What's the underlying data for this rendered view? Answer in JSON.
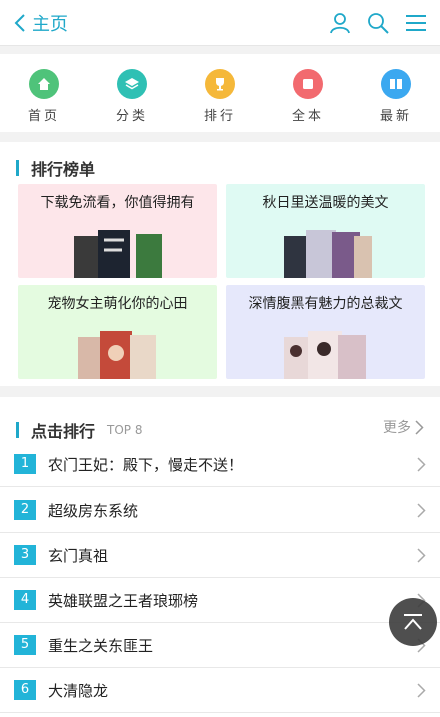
{
  "header": {
    "back_label": "主页"
  },
  "nav": [
    {
      "label": "首页",
      "icon": "home-icon",
      "color": "#4fc37a"
    },
    {
      "label": "分类",
      "icon": "layers-icon",
      "color": "#2fc0b4"
    },
    {
      "label": "排行",
      "icon": "trophy-icon",
      "color": "#f5b83a"
    },
    {
      "label": "全本",
      "icon": "book-square-icon",
      "color": "#f26a6f"
    },
    {
      "label": "最新",
      "icon": "open-book-icon",
      "color": "#3ba8f0"
    }
  ],
  "rank_section": {
    "title": "排行榜单",
    "cards": [
      {
        "title": "下载免流看，你值得拥有",
        "bg": "#fde6ea"
      },
      {
        "title": "秋日里送温暖的美文",
        "bg": "#dffaf3"
      },
      {
        "title": "宠物女主萌化你的心田",
        "bg": "#e4fbe0"
      },
      {
        "title": "深情腹黑有魅力的总裁文",
        "bg": "#e6e8fb"
      }
    ]
  },
  "click_section": {
    "title": "点击排行",
    "subtitle": "TOP 8",
    "more": "更多",
    "items": [
      {
        "num": "1",
        "title": "农门王妃：殿下，慢走不送！"
      },
      {
        "num": "2",
        "title": "超级房东系统"
      },
      {
        "num": "3",
        "title": "玄门真祖"
      },
      {
        "num": "4",
        "title": "英雄联盟之王者琅琊榜"
      },
      {
        "num": "5",
        "title": "重生之关东匪王"
      },
      {
        "num": "6",
        "title": "大清隐龙"
      }
    ]
  }
}
